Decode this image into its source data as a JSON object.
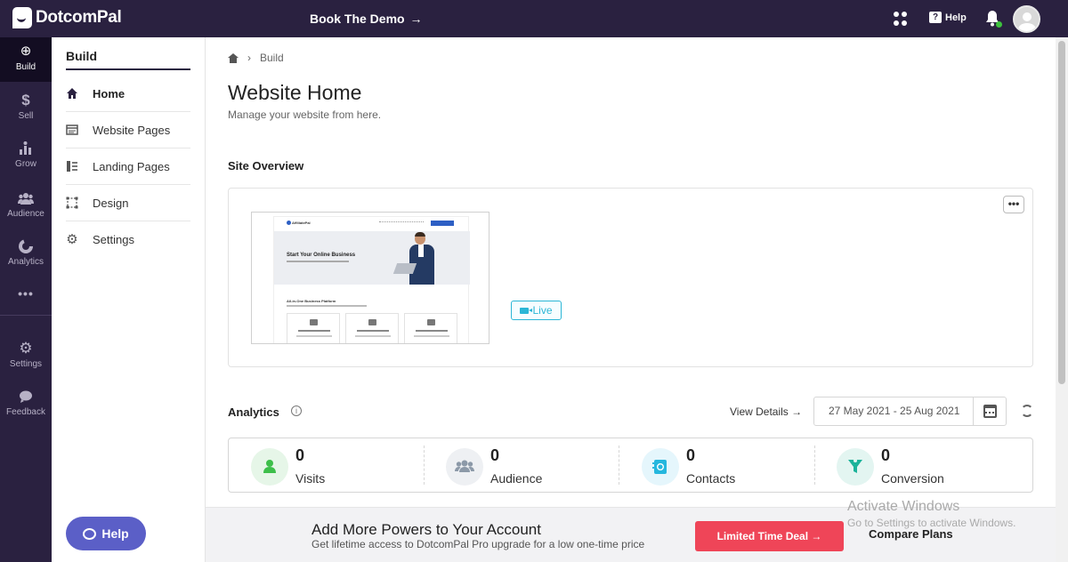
{
  "app": {
    "name": "DotcomPal",
    "book_demo": "Book The Demo",
    "help": "Help"
  },
  "rail": [
    {
      "label": "Build",
      "icon": "plus-circle-icon"
    },
    {
      "label": "Sell",
      "icon": "dollar-icon"
    },
    {
      "label": "Grow",
      "icon": "grow-icon"
    },
    {
      "label": "Audience",
      "icon": "audience-icon"
    },
    {
      "label": "Analytics",
      "icon": "analytics-icon"
    },
    {
      "label": "",
      "icon": "more-icon"
    },
    {
      "label": "Settings",
      "icon": "gear-icon"
    },
    {
      "label": "Feedback",
      "icon": "feedback-icon"
    }
  ],
  "subnav": {
    "title": "Build",
    "items": [
      {
        "label": "Home",
        "icon": "home-icon"
      },
      {
        "label": "Website Pages",
        "icon": "pages-icon"
      },
      {
        "label": "Landing Pages",
        "icon": "landing-icon"
      },
      {
        "label": "Design",
        "icon": "design-icon"
      },
      {
        "label": "Settings",
        "icon": "gear-icon"
      }
    ],
    "help_button": "Help"
  },
  "breadcrumb": {
    "current": "Build"
  },
  "page": {
    "title": "Website Home",
    "subtitle": "Manage your website from here."
  },
  "overview": {
    "title": "Site Overview",
    "status": "Live",
    "preview": {
      "brand": "AffiliatePal",
      "headline": "Start Your Online Business",
      "section": "All-in-One Business Platform"
    }
  },
  "analytics": {
    "title": "Analytics",
    "view_details": "View Details →",
    "date_range": "27 May 2021 - 25 Aug 2021",
    "stats": [
      {
        "value": "0",
        "label": "Visits",
        "color": "#3dbf4a",
        "bg": "#e6f6e8"
      },
      {
        "value": "0",
        "label": "Audience",
        "color": "#8c99a8",
        "bg": "#eef0f3"
      },
      {
        "value": "0",
        "label": "Contacts",
        "color": "#25b7de",
        "bg": "#e5f6fc"
      },
      {
        "value": "0",
        "label": "Conversion",
        "color": "#1bb39a",
        "bg": "#e3f5f1"
      }
    ]
  },
  "footer": {
    "title": "Add More Powers to Your Account",
    "subtitle": "Get lifetime access to DotcomPal Pro upgrade for a low one-time price",
    "deal_button": "Limited Time Deal →",
    "compare": "Compare Plans",
    "watermark_title": "Activate Windows",
    "watermark_sub": "Go to Settings to activate Windows."
  }
}
